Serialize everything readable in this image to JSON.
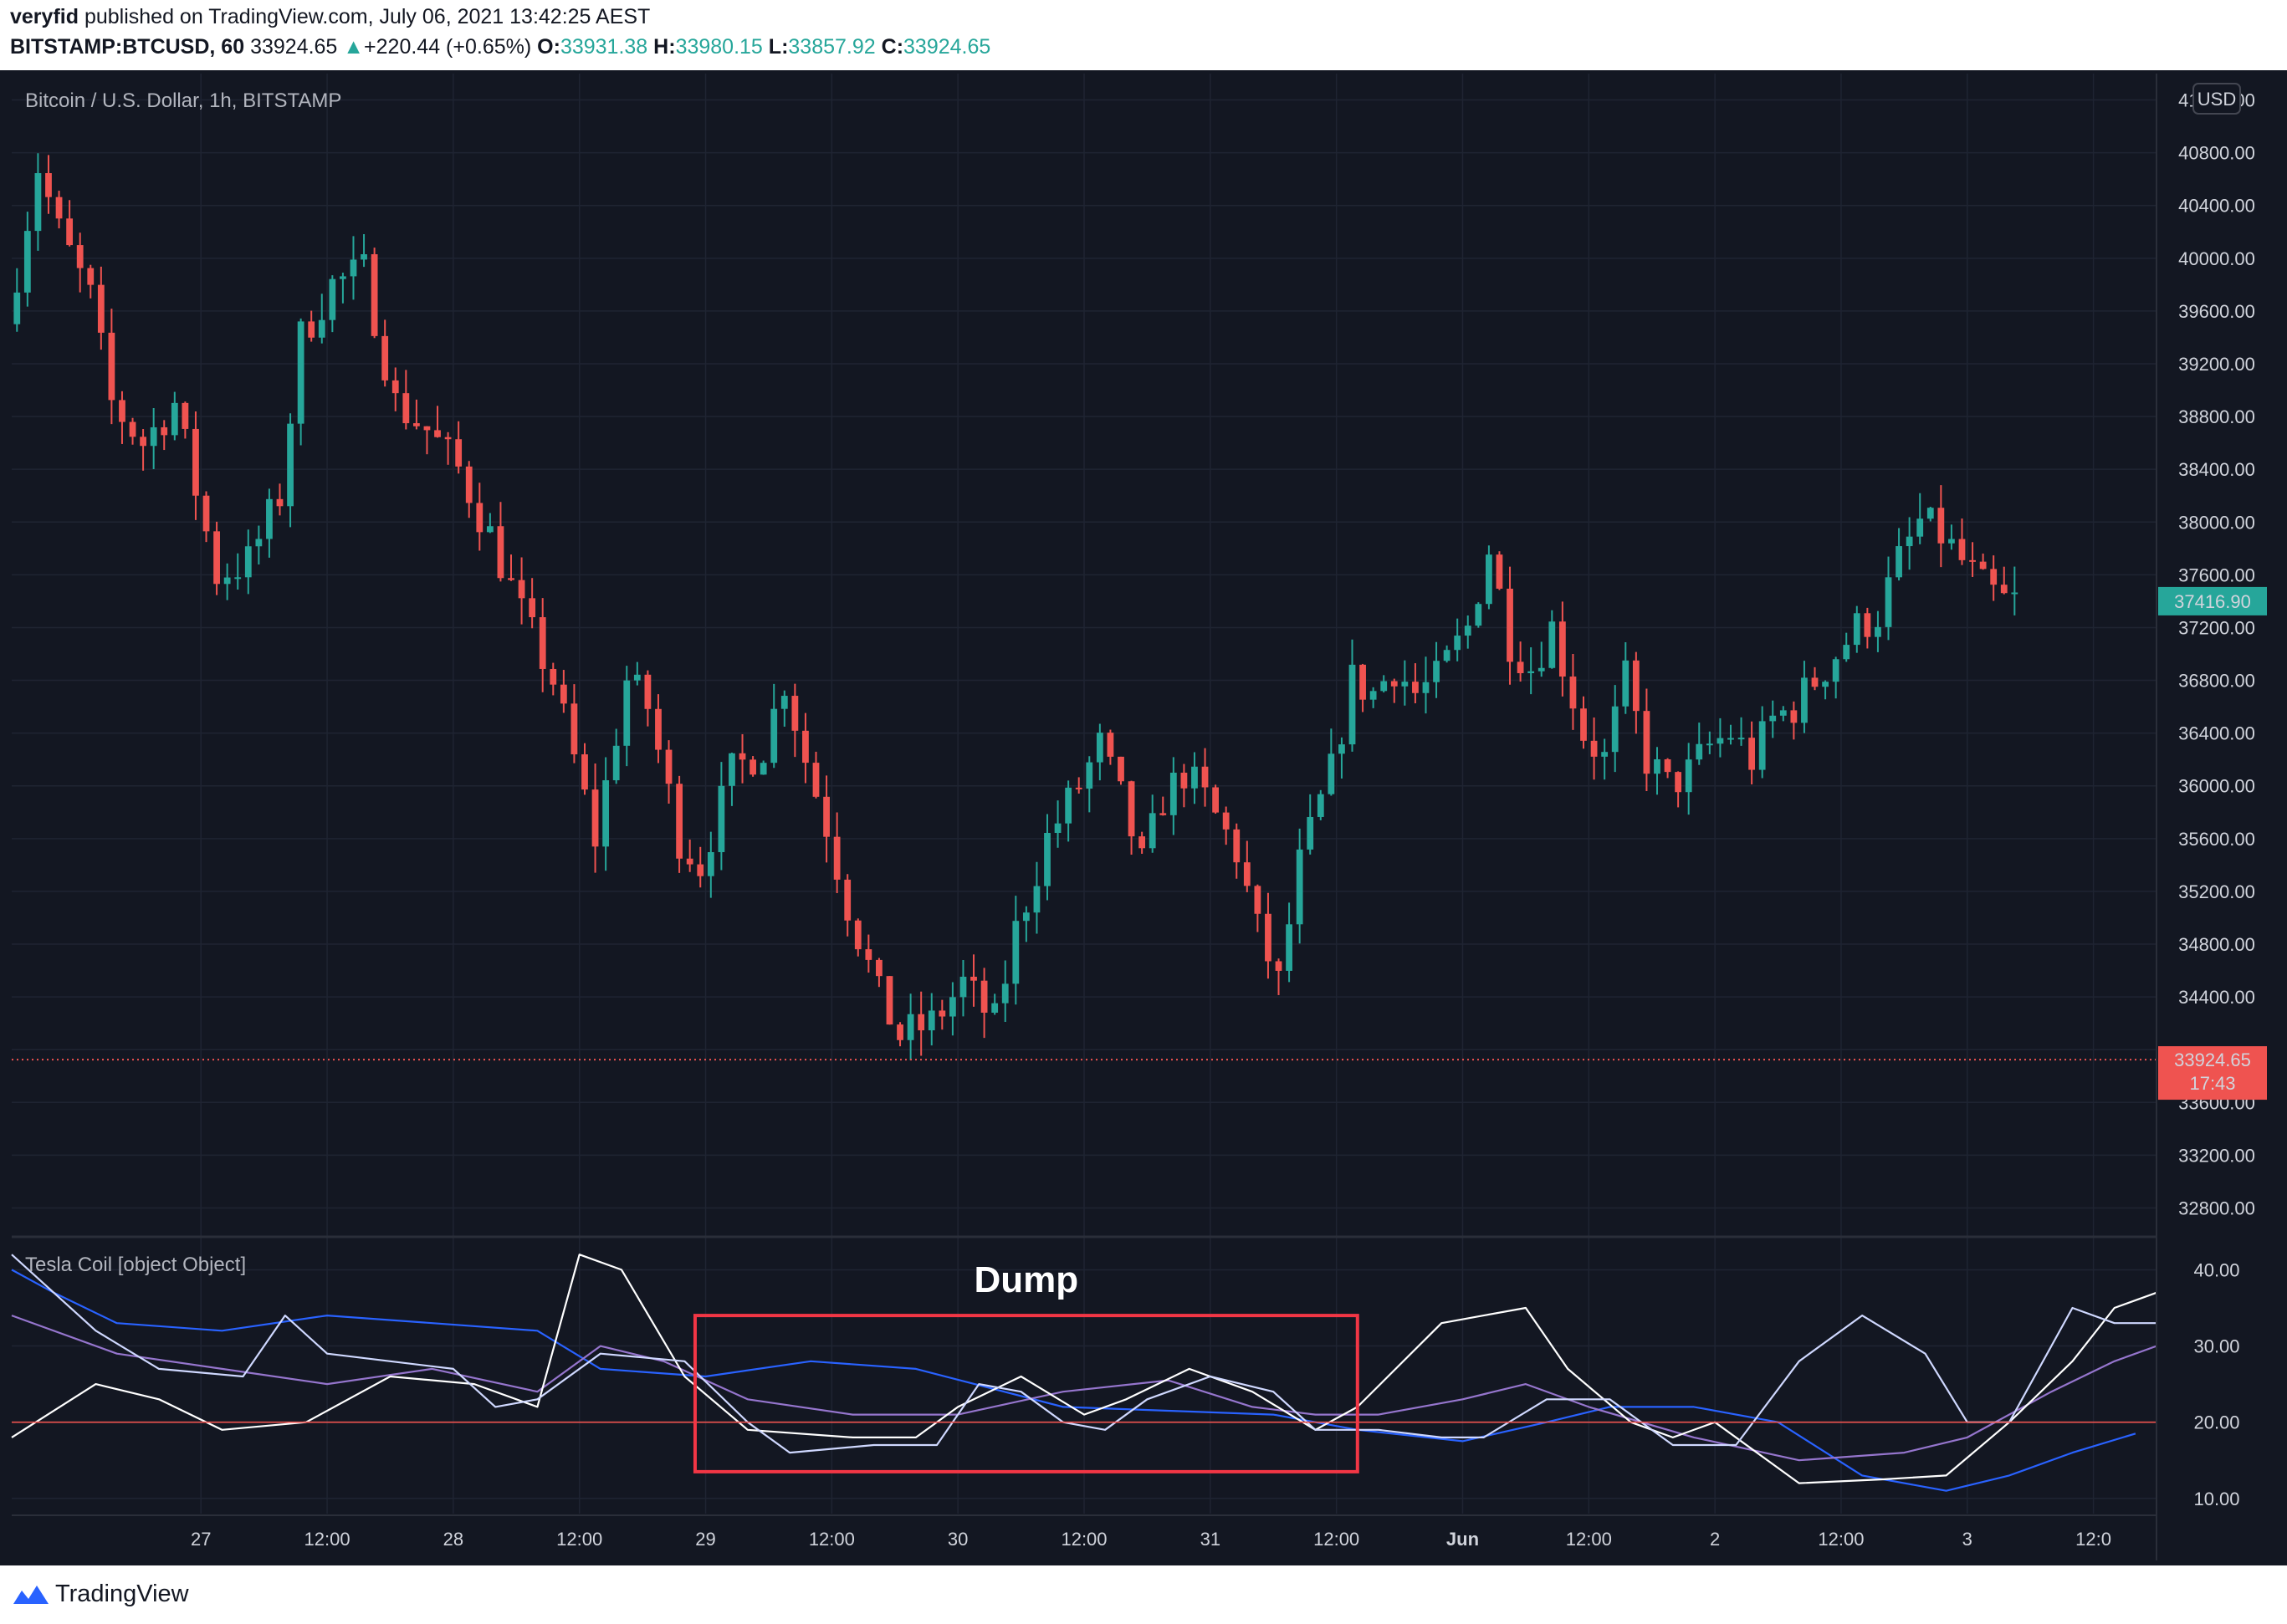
{
  "header": {
    "author": "veryfid",
    "published_text": "published on TradingView.com, July 06, 2021 13:42:25 AEST",
    "symbol": "BITSTAMP:BTCUSD, 60",
    "last": "33924.65",
    "change": "+220.44 (+0.65%)",
    "o_label": "O:",
    "o_value": "33931.38",
    "h_label": "H:",
    "h_value": "33980.15",
    "l_label": "L:",
    "l_value": "33857.92",
    "c_label": "C:",
    "c_value": "33924.65"
  },
  "footer": {
    "brand": "TradingView"
  },
  "colors": {
    "up": "#26a69a",
    "down": "#ef5350",
    "background": "#131722",
    "grid": "#1f2432",
    "annotation": "#f23645"
  },
  "chart_data": [
    {
      "type": "candlestick",
      "title": "Bitcoin / U.S. Dollar, 1h, BITSTAMP",
      "currency_label": "USD",
      "ylim": [
        32600,
        41400
      ],
      "y_ticks": [
        32800,
        33200,
        33600,
        34000,
        34400,
        34800,
        35200,
        35600,
        36000,
        36400,
        36800,
        37200,
        37600,
        38000,
        38400,
        38800,
        39200,
        39600,
        40000,
        40400,
        40800,
        41200
      ],
      "y_tick_labels": [
        "32800.00",
        "33200.00",
        "33600.00",
        "",
        "34400.00",
        "34800.00",
        "35200.00",
        "35600.00",
        "36000.00",
        "36400.00",
        "36800.00",
        "37200.00",
        "37600.00",
        "38000.00",
        "38400.00",
        "38800.00",
        "39200.00",
        "39600.00",
        "40000.00",
        "40400.00",
        "40800.00",
        "41200.00"
      ],
      "x_labels": [
        "27",
        "12:00",
        "28",
        "12:00",
        "29",
        "12:00",
        "30",
        "12:00",
        "31",
        "12:00",
        "Jun",
        "12:00",
        "2",
        "12:00",
        "3",
        "12:0"
      ],
      "x_label_hours": [
        18,
        30,
        42,
        54,
        66,
        78,
        90,
        102,
        114,
        126,
        138,
        150,
        162,
        174,
        186,
        198
      ],
      "hours_span": [
        0,
        204
      ],
      "price_line": 33924.65,
      "price_tag": {
        "value": "33924.65",
        "countdown": "17:43"
      },
      "last_tag": "37416.90",
      "anchors": [
        [
          0,
          39500
        ],
        [
          3,
          40700
        ],
        [
          5,
          40200
        ],
        [
          8,
          39700
        ],
        [
          10,
          38900
        ],
        [
          13,
          38600
        ],
        [
          16,
          38900
        ],
        [
          20,
          37600
        ],
        [
          23,
          37700
        ],
        [
          26,
          38200
        ],
        [
          28,
          39400
        ],
        [
          31,
          39800
        ],
        [
          34,
          39900
        ],
        [
          37,
          38900
        ],
        [
          40,
          38700
        ],
        [
          43,
          38400
        ],
        [
          46,
          37900
        ],
        [
          49,
          37300
        ],
        [
          52,
          36800
        ],
        [
          54,
          36200
        ],
        [
          56,
          35600
        ],
        [
          59,
          36800
        ],
        [
          61,
          36600
        ],
        [
          64,
          35600
        ],
        [
          66,
          35400
        ],
        [
          69,
          36100
        ],
        [
          72,
          36300
        ],
        [
          74,
          36800
        ],
        [
          76,
          36200
        ],
        [
          78,
          35700
        ],
        [
          80,
          35100
        ],
        [
          83,
          34400
        ],
        [
          85,
          34100
        ],
        [
          88,
          34200
        ],
        [
          91,
          34500
        ],
        [
          94,
          34200
        ],
        [
          96,
          34900
        ],
        [
          99,
          35600
        ],
        [
          102,
          36000
        ],
        [
          104,
          36300
        ],
        [
          106,
          35900
        ],
        [
          108,
          35400
        ],
        [
          110,
          35900
        ],
        [
          112,
          36100
        ],
        [
          114,
          35900
        ],
        [
          117,
          35500
        ],
        [
          119,
          34900
        ],
        [
          121,
          34500
        ],
        [
          123,
          35400
        ],
        [
          126,
          36100
        ],
        [
          128,
          36800
        ],
        [
          130,
          36700
        ],
        [
          132,
          36900
        ],
        [
          134,
          36700
        ],
        [
          136,
          36800
        ],
        [
          139,
          37200
        ],
        [
          141,
          37800
        ],
        [
          143,
          37100
        ],
        [
          145,
          36900
        ],
        [
          147,
          37200
        ],
        [
          150,
          36400
        ],
        [
          152,
          36200
        ],
        [
          154,
          36800
        ],
        [
          156,
          36200
        ],
        [
          158,
          36000
        ],
        [
          160,
          36100
        ],
        [
          162,
          36300
        ],
        [
          164,
          36400
        ],
        [
          166,
          36200
        ],
        [
          168,
          36500
        ],
        [
          170,
          36600
        ],
        [
          172,
          36800
        ],
        [
          174,
          37000
        ],
        [
          176,
          37200
        ],
        [
          178,
          37300
        ],
        [
          180,
          37700
        ],
        [
          182,
          38000
        ],
        [
          184,
          37900
        ],
        [
          186,
          37700
        ],
        [
          188,
          37500
        ],
        [
          190,
          37400
        ]
      ],
      "series": [
        {
          "name": "BTCUSD",
          "kind": "ohlc_hourly"
        }
      ]
    },
    {
      "type": "line",
      "title": "Tesla Coil [object Object]",
      "ylim": [
        8,
        44
      ],
      "y_ticks": [
        10,
        20,
        30,
        40
      ],
      "y_tick_labels": [
        "10.00",
        "20.00",
        "30.00",
        "40.00"
      ],
      "hline": 20,
      "annotation": {
        "label": "Dump",
        "x_hours": [
          65,
          128
        ],
        "y_range": [
          13.5,
          34
        ]
      },
      "series": [
        {
          "color": "#2962ff",
          "points": [
            [
              0,
              40
            ],
            [
              4,
              37
            ],
            [
              10,
              33
            ],
            [
              20,
              32
            ],
            [
              30,
              34
            ],
            [
              40,
              33
            ],
            [
              50,
              32
            ],
            [
              56,
              27
            ],
            [
              66,
              26
            ],
            [
              76,
              28
            ],
            [
              86,
              27
            ],
            [
              100,
              22
            ],
            [
              110,
              21.5
            ],
            [
              120,
              21
            ],
            [
              128,
              19
            ],
            [
              138,
              17.5
            ],
            [
              146,
              20
            ],
            [
              152,
              22
            ],
            [
              160,
              22
            ],
            [
              168,
              20
            ],
            [
              176,
              13
            ],
            [
              184,
              11
            ],
            [
              190,
              13
            ],
            [
              196,
              16
            ],
            [
              202,
              18.5
            ]
          ]
        },
        {
          "color": "#9575cd",
          "points": [
            [
              0,
              34
            ],
            [
              10,
              29
            ],
            [
              20,
              27
            ],
            [
              30,
              25
            ],
            [
              40,
              27
            ],
            [
              50,
              24
            ],
            [
              56,
              30
            ],
            [
              62,
              28
            ],
            [
              70,
              23
            ],
            [
              80,
              21
            ],
            [
              90,
              21
            ],
            [
              100,
              24
            ],
            [
              110,
              25.5
            ],
            [
              118,
              22
            ],
            [
              124,
              21
            ],
            [
              130,
              21
            ],
            [
              138,
              23
            ],
            [
              144,
              25
            ],
            [
              150,
              22
            ],
            [
              160,
              18
            ],
            [
              170,
              15
            ],
            [
              180,
              16
            ],
            [
              186,
              18
            ],
            [
              194,
              24
            ],
            [
              200,
              28
            ],
            [
              204,
              30
            ]
          ]
        },
        {
          "color": "#ffffff",
          "points": [
            [
              0,
              18
            ],
            [
              8,
              25
            ],
            [
              14,
              23
            ],
            [
              20,
              19
            ],
            [
              28,
              20
            ],
            [
              36,
              26
            ],
            [
              44,
              25
            ],
            [
              50,
              22
            ],
            [
              54,
              42
            ],
            [
              58,
              40
            ],
            [
              64,
              26
            ],
            [
              70,
              19
            ],
            [
              80,
              18
            ],
            [
              86,
              18
            ],
            [
              90,
              22
            ],
            [
              96,
              26
            ],
            [
              102,
              21
            ],
            [
              106,
              23
            ],
            [
              112,
              27
            ],
            [
              118,
              24
            ],
            [
              124,
              19
            ],
            [
              128,
              22
            ],
            [
              136,
              33
            ],
            [
              140,
              34
            ],
            [
              144,
              35
            ],
            [
              148,
              27
            ],
            [
              154,
              20
            ],
            [
              158,
              18
            ],
            [
              162,
              20
            ],
            [
              170,
              12
            ],
            [
              178,
              12.5
            ],
            [
              184,
              13
            ],
            [
              190,
              20
            ],
            [
              196,
              28
            ],
            [
              200,
              35
            ],
            [
              204,
              37
            ]
          ]
        },
        {
          "color": "#cfd8ff",
          "points": [
            [
              0,
              42
            ],
            [
              8,
              32
            ],
            [
              14,
              27
            ],
            [
              22,
              26
            ],
            [
              26,
              34
            ],
            [
              30,
              29
            ],
            [
              36,
              28
            ],
            [
              42,
              27
            ],
            [
              46,
              22
            ],
            [
              50,
              23
            ],
            [
              56,
              29
            ],
            [
              64,
              28
            ],
            [
              70,
              20
            ],
            [
              74,
              16
            ],
            [
              82,
              17
            ],
            [
              88,
              17
            ],
            [
              92,
              25
            ],
            [
              96,
              24
            ],
            [
              100,
              20
            ],
            [
              104,
              19
            ],
            [
              108,
              23
            ],
            [
              114,
              26
            ],
            [
              120,
              24
            ],
            [
              124,
              19
            ],
            [
              130,
              19
            ],
            [
              136,
              18
            ],
            [
              140,
              18
            ],
            [
              146,
              23
            ],
            [
              152,
              23
            ],
            [
              158,
              17
            ],
            [
              164,
              17
            ],
            [
              170,
              28
            ],
            [
              176,
              34
            ],
            [
              182,
              29
            ],
            [
              186,
              20
            ],
            [
              190,
              20
            ],
            [
              196,
              35
            ],
            [
              200,
              33
            ],
            [
              204,
              33
            ]
          ]
        }
      ]
    }
  ]
}
